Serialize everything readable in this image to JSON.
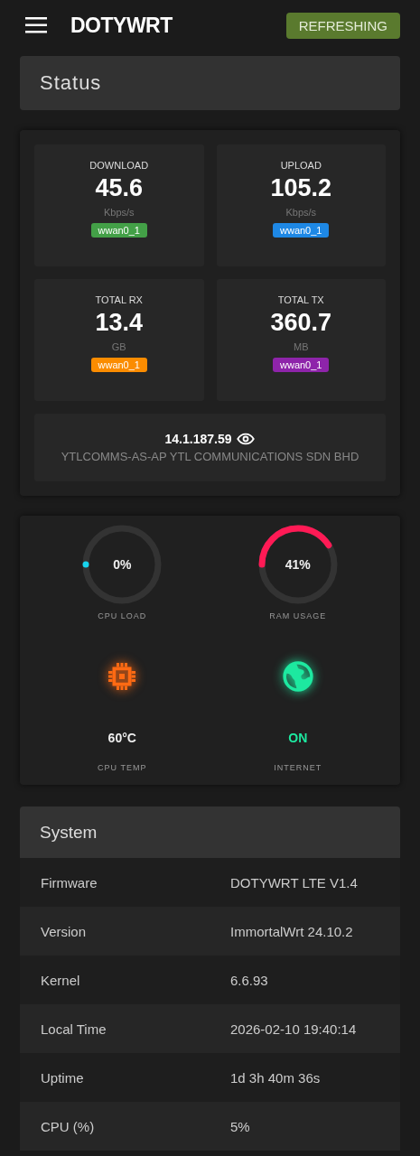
{
  "header": {
    "brand": "DOTYWRT",
    "refresh_button": "REFRESHING"
  },
  "status_title": "Status",
  "traffic": [
    {
      "label": "DOWNLOAD",
      "value": "45.6",
      "unit": "Kbps/s",
      "tag": "wwan0_1",
      "color": "#43a047"
    },
    {
      "label": "UPLOAD",
      "value": "105.2",
      "unit": "Kbps/s",
      "tag": "wwan0_1",
      "color": "#1e88e5"
    },
    {
      "label": "TOTAL RX",
      "value": "13.4",
      "unit": "GB",
      "tag": "wwan0_1",
      "color": "#fb8c00"
    },
    {
      "label": "TOTAL TX",
      "value": "360.7",
      "unit": "MB",
      "tag": "wwan0_1",
      "color": "#8e24aa"
    }
  ],
  "wan": {
    "ip": "14.1.187.59",
    "isp": "YTLCOMMS-AS-AP YTL COMMUNICATIONS SDN BHD"
  },
  "gauges": [
    {
      "kind": "ring",
      "value": "0%",
      "label": "CPU LOAD",
      "color": "#17d4ee"
    },
    {
      "kind": "ring",
      "value": "41%",
      "label": "RAM USAGE",
      "color": "#ff1a55"
    },
    {
      "kind": "chip",
      "value": "60°C",
      "label": "CPU TEMP",
      "color": "#ff6a13"
    },
    {
      "kind": "globe",
      "value": "ON",
      "label": "INTERNET",
      "color": "#1de9a0"
    }
  ],
  "system": {
    "title": "System",
    "rows": [
      {
        "key": "Firmware",
        "value": "DOTYWRT LTE V1.4"
      },
      {
        "key": "Version",
        "value": "ImmortalWrt 24.10.2"
      },
      {
        "key": "Kernel",
        "value": "6.6.93"
      },
      {
        "key": "Local Time",
        "value": "2026-02-10 19:40:14"
      },
      {
        "key": "Uptime",
        "value": "1d 3h 40m 36s"
      },
      {
        "key": "CPU (%)",
        "value": "5%"
      }
    ]
  }
}
